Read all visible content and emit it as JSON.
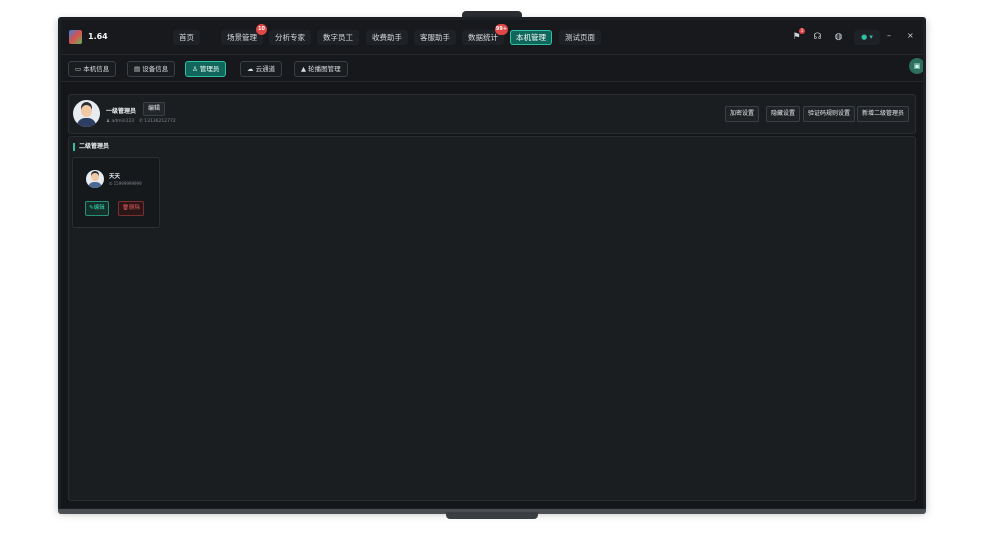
{
  "app": {
    "version": "1.64"
  },
  "nav": [
    {
      "label": "首页"
    },
    {
      "label": "场景管理",
      "badge": "10"
    },
    {
      "label": "分析专家"
    },
    {
      "label": "数字员工"
    },
    {
      "label": "收费助手"
    },
    {
      "label": "客服助手"
    },
    {
      "label": "数据统计",
      "badge": "99+"
    },
    {
      "label": "本机管理",
      "active": true
    },
    {
      "label": "测试页面"
    }
  ],
  "toolbar": {
    "message_badge": "1",
    "minimize": "–",
    "close": "×",
    "user_caret": "▾"
  },
  "subnav": [
    {
      "label": "本机信息",
      "icon": "monitor-icon"
    },
    {
      "label": "设备信息",
      "icon": "device-icon"
    },
    {
      "label": "管理员",
      "icon": "user-icon",
      "active": true
    },
    {
      "label": "云通道",
      "icon": "cloud-icon"
    },
    {
      "label": "轮播图管理",
      "icon": "image-icon"
    }
  ],
  "profile": {
    "role": "一级管理员",
    "edit_label": "编辑",
    "username": "admin123",
    "phone": "13136212772",
    "actions": [
      "加密设置",
      "隐藏设置",
      "验证码规则设置",
      "新增二级管理员"
    ]
  },
  "secondary": {
    "title": "二级管理员",
    "admins": [
      {
        "name": "天天",
        "phone": "15999999999",
        "edit_label": "编辑",
        "delete_label": "删除"
      }
    ]
  },
  "colors": {
    "accent": "#2fbfa5",
    "active_bg": "#10665a",
    "danger": "#e05a5a",
    "background": "#141619"
  }
}
